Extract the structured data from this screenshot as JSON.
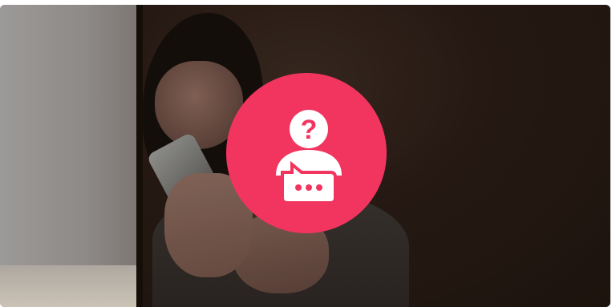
{
  "banner": {
    "image_description_hidden": "",
    "badge": {
      "color": "#f2355f",
      "icon": "anonymous-chat-user-icon",
      "glyph": "?"
    }
  }
}
